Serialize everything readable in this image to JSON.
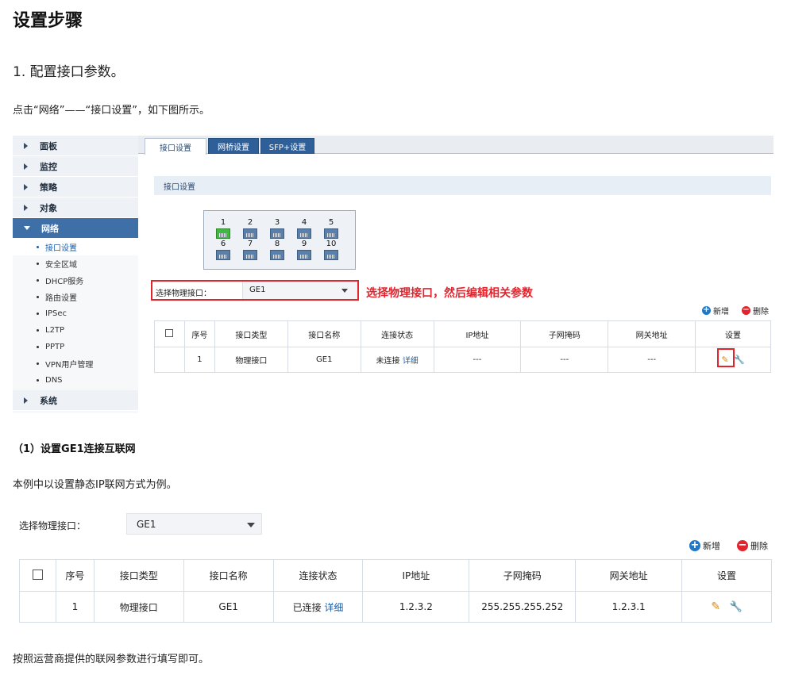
{
  "heading": "设置步骤",
  "step1": "1. 配置接口参数。",
  "instruction": "点击“网络”——“接口设置”，如下图所示。",
  "sidebar": {
    "items": [
      {
        "label": "面板",
        "active": false
      },
      {
        "label": "监控",
        "active": false
      },
      {
        "label": "策略",
        "active": false
      },
      {
        "label": "对象",
        "active": false
      },
      {
        "label": "网络",
        "active": true
      }
    ],
    "subitems": [
      "接口设置",
      "安全区域",
      "DHCP服务",
      "路由设置",
      "IPSec",
      "L2TP",
      "PPTP",
      "VPN用户管理",
      "DNS"
    ],
    "selected_sub": "接口设置",
    "last_item": "系统"
  },
  "tabs": [
    "接口设置",
    "网桥设置",
    "SFP+设置"
  ],
  "section_title": "接口设置",
  "ports_top": [
    "1",
    "2",
    "3",
    "4",
    "5"
  ],
  "ports_bottom": [
    "6",
    "7",
    "8",
    "9",
    "10"
  ],
  "select1": {
    "label": "选择物理接口：",
    "value": "GE1"
  },
  "annotation": "选择物理接口，然后编辑相关参数",
  "actions": {
    "add": "新增",
    "delete": "删除"
  },
  "table1": {
    "headers": [
      "",
      "序号",
      "接口类型",
      "接口名称",
      "连接状态",
      "IP地址",
      "子网掩码",
      "网关地址",
      "设置"
    ],
    "row": {
      "index": "1",
      "type": "物理接口",
      "name": "GE1",
      "status": "未连接",
      "detail": "详细",
      "ip": "---",
      "mask": "---",
      "gateway": "---"
    }
  },
  "sub_heading": "（1）设置GE1连接互联网",
  "example_text": "本例中以设置静态IP联网方式为例。",
  "select2": {
    "label": "选择物理接口：",
    "value": "GE1"
  },
  "table2": {
    "headers": [
      "",
      "序号",
      "接口类型",
      "接口名称",
      "连接状态",
      "IP地址",
      "子网掩码",
      "网关地址",
      "设置"
    ],
    "row": {
      "index": "1",
      "type": "物理接口",
      "name": "GE1",
      "status": "已连接",
      "detail": "详细",
      "ip": "1.2.3.2",
      "mask": "255.255.255.252",
      "gateway": "1.2.3.1"
    }
  },
  "footer_text": "按照运营商提供的联网参数进行填写即可。",
  "colors": {
    "accent_red": "#e2242d",
    "nav_blue": "#3f6fa7",
    "link_blue": "#1a5fa8",
    "port_green": "#3fb93f"
  }
}
